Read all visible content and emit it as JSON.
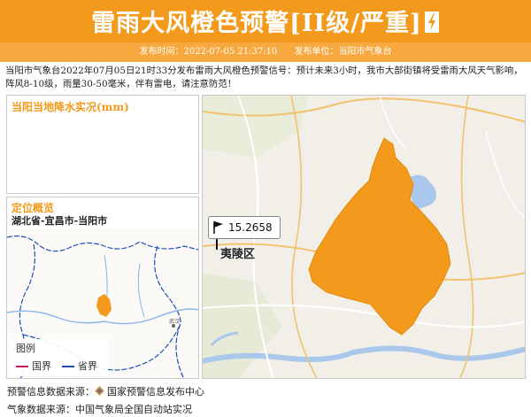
{
  "header": {
    "title": "雷雨大风橙色预警[II级/严重]",
    "publish_time_label": "发布时间：2022-07-05 21:37:10",
    "publish_unit_label": "发布单位：当阳市气象台"
  },
  "description": "当阳市气象台2022年07月05日21时33分发布雷雨大风橙色预警信号：预计未来3小时，我市大部街镇将受雷雨大风天气影响，阵风8-10级，雨量30-50毫米，伴有雷电，请注意防范！",
  "rain_panel": {
    "title": "当阳当地降水实况(mm)"
  },
  "location_panel": {
    "title": "定位概览",
    "path": "湖北省-宜昌市-当阳市",
    "legend": {
      "title": "图例",
      "items": [
        {
          "label": "国界",
          "color": "#c2185b"
        },
        {
          "label": "省界",
          "color": "#1e4fb8"
        }
      ]
    }
  },
  "main_map": {
    "marker_value": "15.2658",
    "district_label": "夷陵区",
    "warning_color": "#f39a1c"
  },
  "footer": {
    "line1_prefix": "预警信息数据来源：",
    "line1_source": "国家预警信息发布中心",
    "line2": "气象数据来源：中国气象局全国自动站实况"
  }
}
